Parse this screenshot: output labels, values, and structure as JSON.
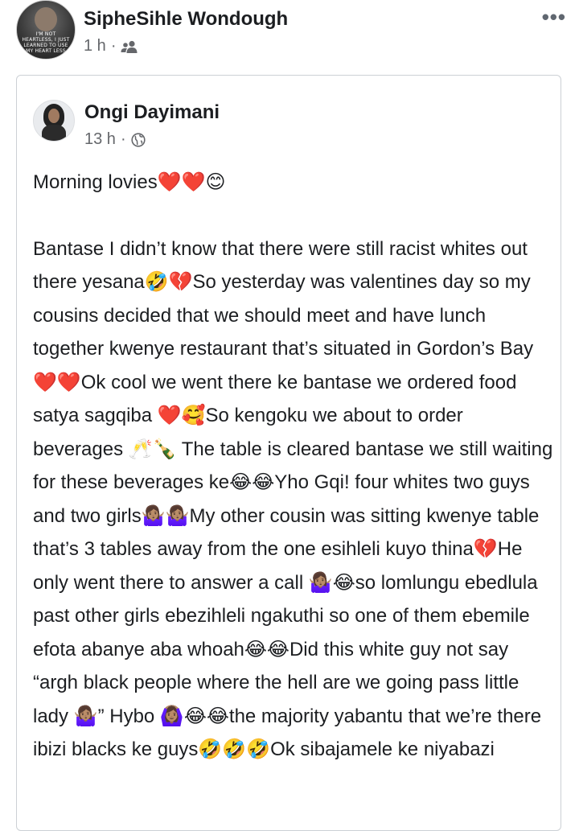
{
  "outer_post": {
    "author": "SipheSihle Wondough",
    "time": "1 h",
    "separator": "·",
    "audience_icon": "friends-icon",
    "more_icon": "more-options-icon",
    "more_glyph": "•••",
    "avatar_text": "I'M NOT HEARTLESS, I JUST LEARNED TO USE MY HEART LESS"
  },
  "shared_post": {
    "author": "Ongi Dayimani",
    "time": "13 h",
    "separator": "·",
    "audience_icon": "globe-icon",
    "paragraphs": [
      "Morning lovies❤️❤️😊",
      "Bantase I didn’t know that there were still racist whites out there yesana🤣💔So yesterday was valentines day so my cousins decided that we should meet and have lunch together kwenye restaurant that’s situated in Gordon’s Bay❤️❤️Ok cool we went there ke bantase we ordered food satya sagqiba ❤️🥰So kengoku we about to order beverages 🥂🍾 The table is cleared bantase we still waiting for these beverages ke😂😂Yho Gqi! four whites two guys and two girls🤷🏽‍♀️🤷🏽‍♀️My other cousin was sitting kwenye table that’s 3 tables away from the one esihleli kuyo thina💔He only went there to answer a call 🤷🏽‍♀️😂so lomlungu ebedlula past other girls ebezihleli ngakuthi so one of them ebemile efota abanye aba whoah😂😂Did this white guy not say “argh black people where the hell are we going pass little lady 🤷🏽‍♀️” Hybo 🙆🏽‍♀️😂😂the majority yabantu that we’re there ibizi blacks ke guys🤣🤣🤣Ok sibajamele ke niyabazi"
    ]
  }
}
